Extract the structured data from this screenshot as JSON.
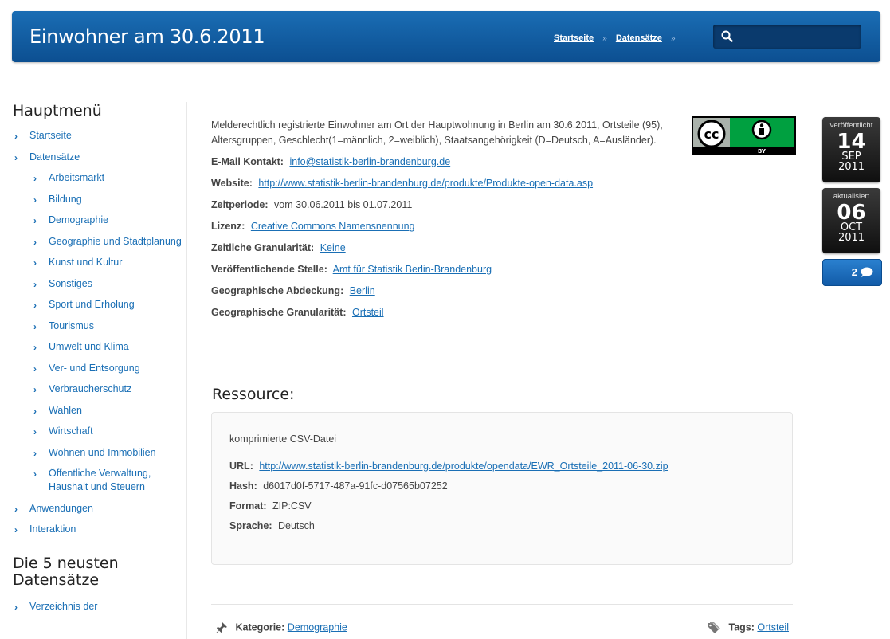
{
  "header": {
    "title": "Einwohner am 30.6.2011",
    "breadcrumb": [
      {
        "label": "Startseite"
      },
      {
        "label": "Datensätze"
      }
    ],
    "breadcrumb_sep": "»",
    "search": {
      "placeholder": ""
    }
  },
  "sidebar": {
    "main_heading": "Hauptmenü",
    "menu": [
      {
        "label": "Startseite",
        "level": 0
      },
      {
        "label": "Datensätze",
        "level": 0
      },
      {
        "label": "Arbeitsmarkt",
        "level": 1
      },
      {
        "label": "Bildung",
        "level": 1
      },
      {
        "label": "Demographie",
        "level": 1
      },
      {
        "label": "Geographie und Stadtplanung",
        "level": 1
      },
      {
        "label": "Kunst und Kultur",
        "level": 1
      },
      {
        "label": "Sonstiges",
        "level": 1
      },
      {
        "label": "Sport und Erholung",
        "level": 1
      },
      {
        "label": "Tourismus",
        "level": 1
      },
      {
        "label": "Umwelt und Klima",
        "level": 1
      },
      {
        "label": "Ver- und Entsorgung",
        "level": 1
      },
      {
        "label": "Verbraucherschutz",
        "level": 1
      },
      {
        "label": "Wahlen",
        "level": 1
      },
      {
        "label": "Wirtschaft",
        "level": 1
      },
      {
        "label": "Wohnen und Immobilien",
        "level": 1
      },
      {
        "label": "Öffentliche Verwaltung, Haushalt und Steuern",
        "level": 1
      },
      {
        "label": "Anwendungen",
        "level": 0
      },
      {
        "label": "Interaktion",
        "level": 0
      }
    ],
    "recent_heading": "Die 5 neusten Datensätze",
    "recent": [
      {
        "label": "Verzeichnis der"
      }
    ]
  },
  "main": {
    "description": "Melderechtlich registrierte Einwohner am Ort der Hauptwohnung in Berlin am 30.6.2011, Ortsteile (95), Altersgruppen, Geschlecht(1=männlich, 2=weiblich), Staatsangehörigkeit (D=Deutsch, A=Ausländer).",
    "fields": [
      {
        "label": "E-Mail Kontakt:",
        "value": "info@statistik-berlin-brandenburg.de",
        "link": true
      },
      {
        "label": "Website:",
        "value": "http://www.statistik-berlin-brandenburg.de/produkte/Produkte-open-data.asp",
        "link": true
      },
      {
        "label": "Zeitperiode:",
        "value": "vom 30.06.2011 bis 01.07.2011",
        "link": false
      },
      {
        "label": "Lizenz:",
        "value": "Creative Commons Namensnennung",
        "link": true
      },
      {
        "label": "Zeitliche Granularität:",
        "value": "Keine",
        "link": true
      },
      {
        "label": "Veröffentlichende Stelle:",
        "value": "Amt für Statistik Berlin-Brandenburg",
        "link": true
      },
      {
        "label": "Geographische Abdeckung:",
        "value": "Berlin",
        "link": true
      },
      {
        "label": "Geographische Granularität:",
        "value": "Ortsteil",
        "link": true
      }
    ],
    "license_badge": {
      "left_text": "cc",
      "right_text": "BY"
    }
  },
  "resource": {
    "heading": "Ressource:",
    "title": "komprimierte CSV-Datei",
    "fields": [
      {
        "label": "URL:",
        "value": "http://www.statistik-berlin-brandenburg.de/produkte/opendata/EWR_Ortsteile_2011-06-30.zip",
        "link": true
      },
      {
        "label": "Hash:",
        "value": "d6017d0f-5717-487a-91fc-d07565b07252",
        "link": false
      },
      {
        "label": "Format:",
        "value": "ZIP:CSV",
        "link": false
      },
      {
        "label": "Sprache:",
        "value": "Deutsch",
        "link": false
      }
    ]
  },
  "footer": {
    "kategorie_label": "Kategorie:",
    "kategorie_value": "Demographie",
    "tags_label": "Tags:",
    "tags_value": "Ortsteil"
  },
  "dates": {
    "published": {
      "label": "veröffentlicht",
      "day": "14",
      "month": "SEP",
      "year": "2011"
    },
    "updated": {
      "label": "aktualisiert",
      "day": "06",
      "month": "OCT",
      "year": "2011"
    },
    "comments_count": "2"
  },
  "colors": {
    "header_blue": "#0c4f91",
    "link": "#1a6fb5",
    "cc_green": "#aab2ab"
  }
}
